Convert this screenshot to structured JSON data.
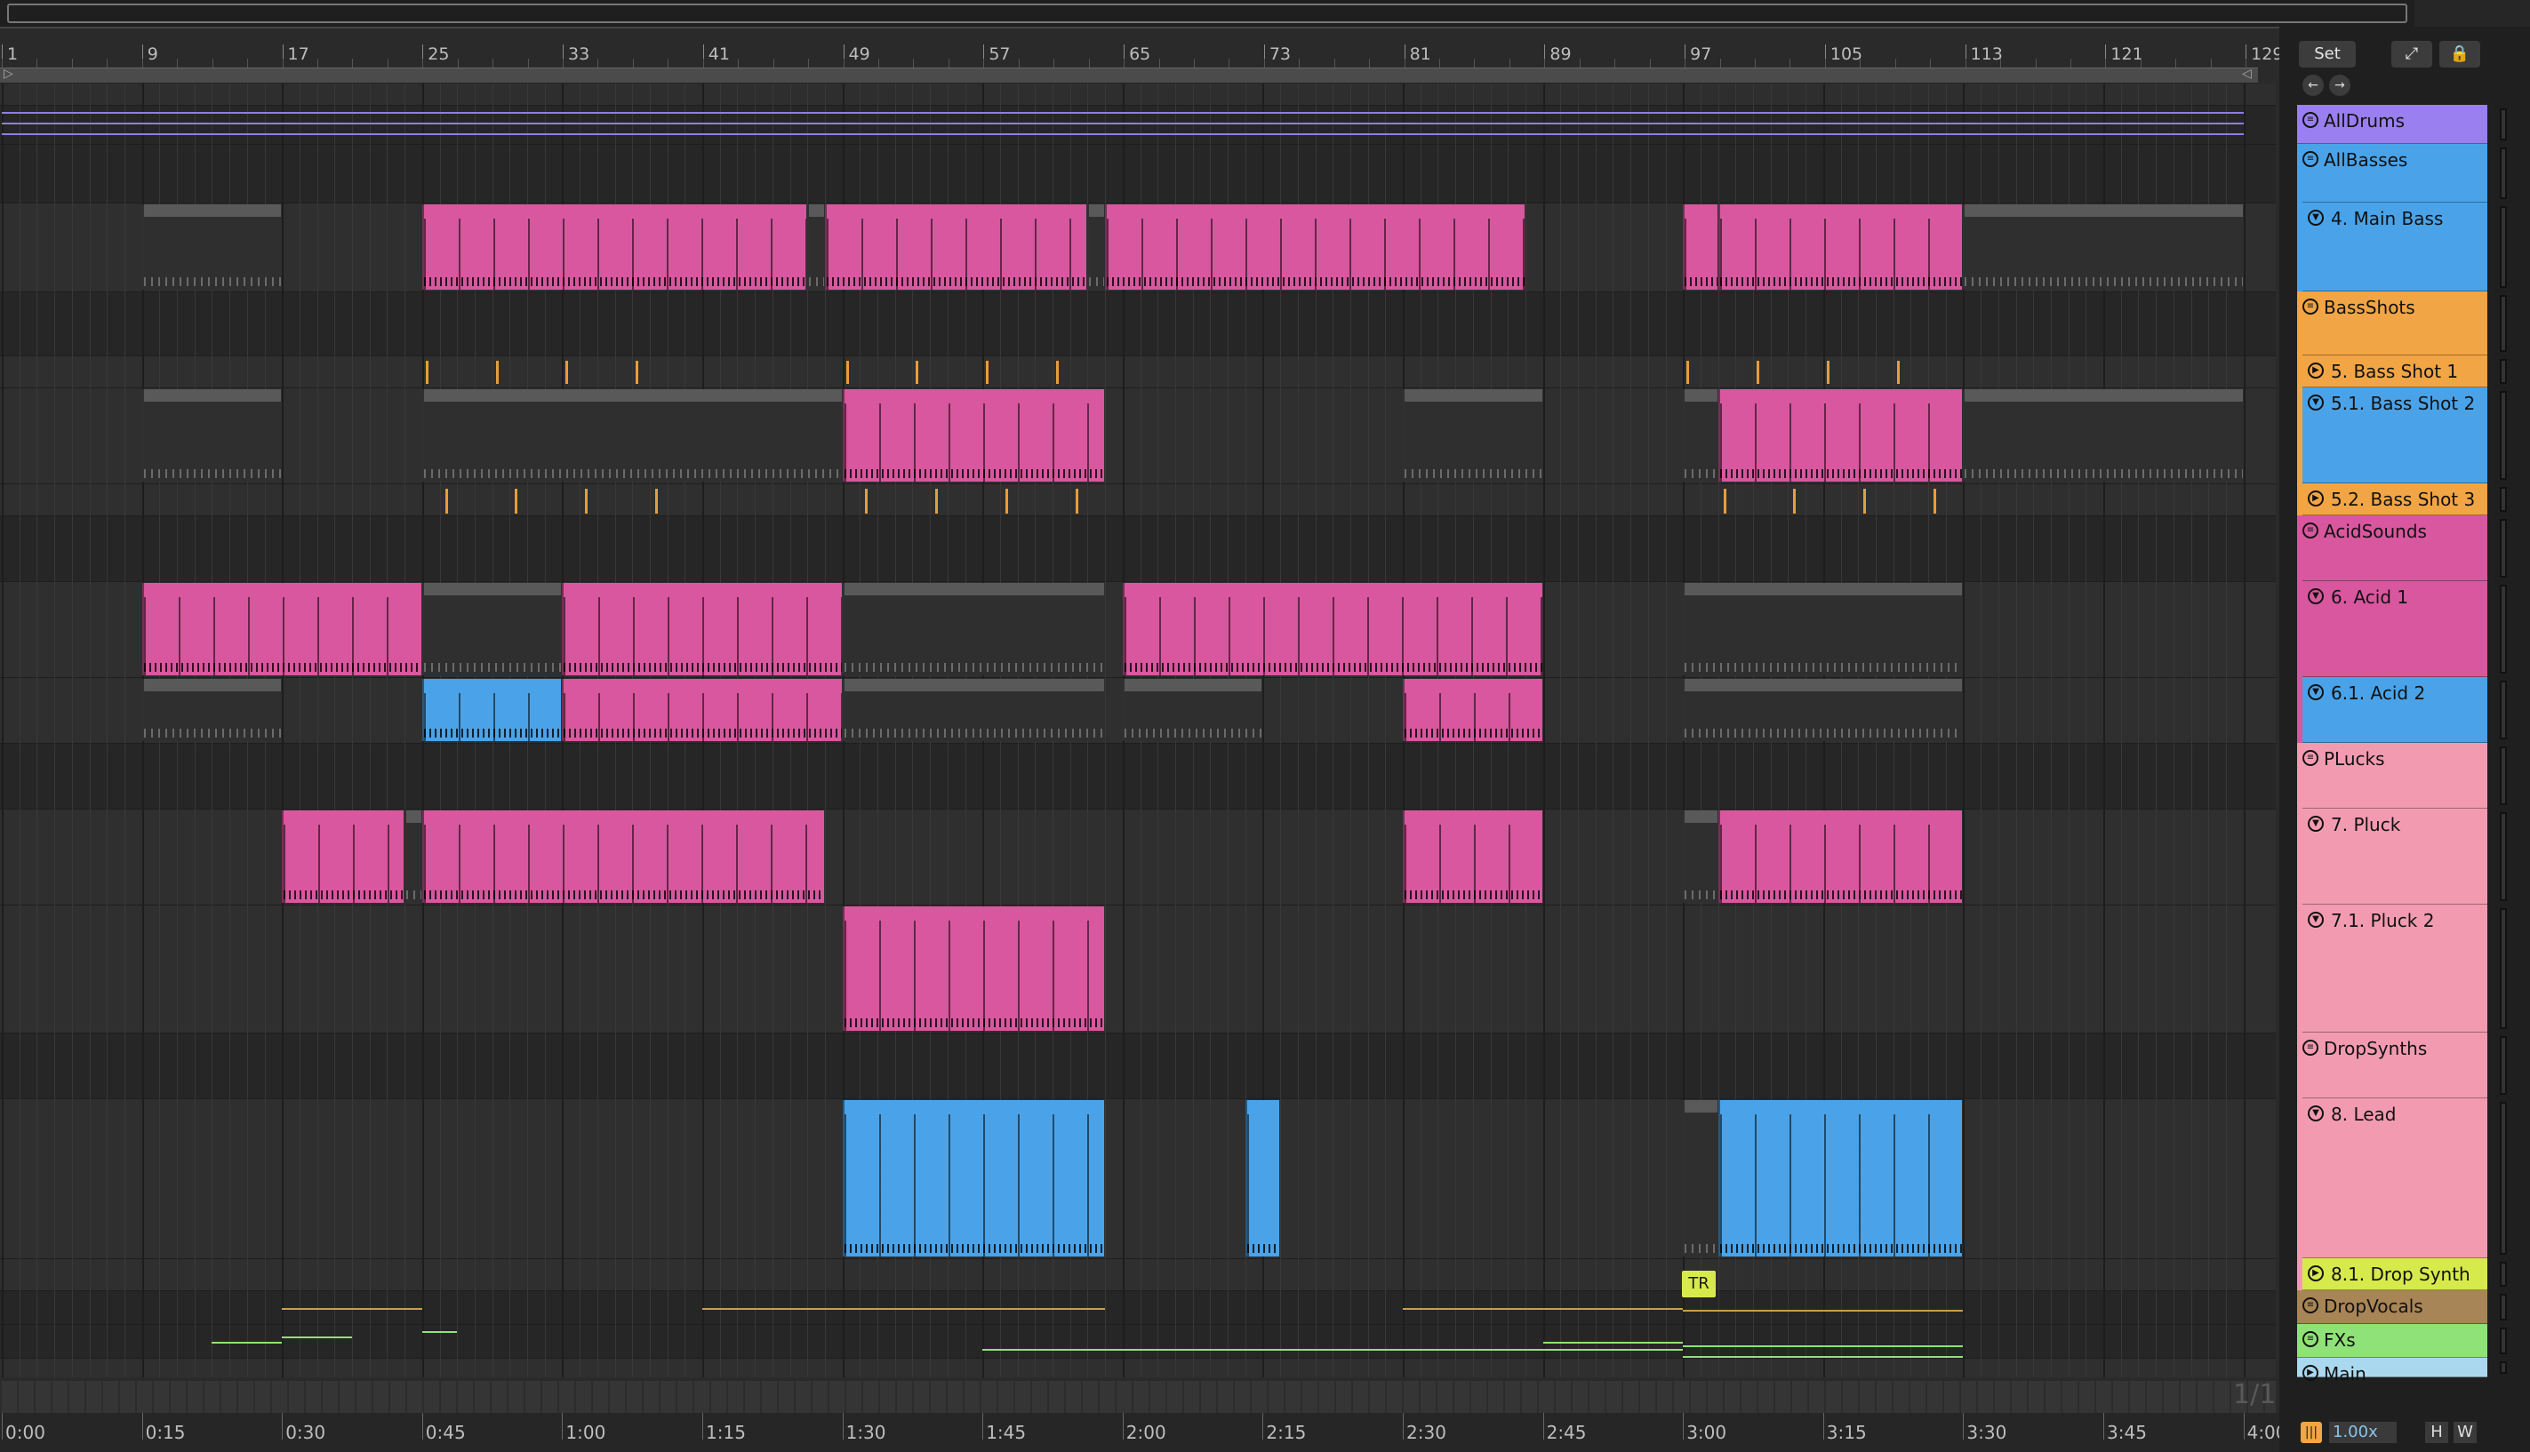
{
  "ruler": {
    "bars": [
      "1",
      "9",
      "17",
      "25",
      "33",
      "41",
      "49",
      "57",
      "65",
      "73",
      "81",
      "89",
      "97",
      "105",
      "113",
      "121",
      "129"
    ]
  },
  "time_ruler": {
    "labels": [
      "0:00",
      "0:15",
      "0:30",
      "0:45",
      "1:00",
      "1:15",
      "1:30",
      "1:45",
      "2:00",
      "2:15",
      "2:30",
      "2:45",
      "3:00",
      "3:15",
      "3:30",
      "3:45",
      "4:00"
    ]
  },
  "controls": {
    "set_label": "Set",
    "expand_icon": "expand-arrows-icon",
    "lock_icon": "lock-icon",
    "back_icon": "arrow-left-icon",
    "forward_icon": "arrow-right-icon"
  },
  "page_indicator": "1/1",
  "locator": {
    "label": "TR"
  },
  "tracks": [
    {
      "name": "AllDrums",
      "kind": "group",
      "color": "#9a7ff0"
    },
    {
      "name": "AllBasses",
      "kind": "group",
      "color": "#4aa3e8"
    },
    {
      "name": "4. Main Bass",
      "kind": "midi",
      "color": "#4aa3e8"
    },
    {
      "name": "BassShots",
      "kind": "group",
      "color": "#f2a544"
    },
    {
      "name": "5. Bass Shot 1",
      "kind": "audio",
      "color": "#f2a544"
    },
    {
      "name": "5.1. Bass Shot 2",
      "kind": "midi",
      "color": "#4aa3e8"
    },
    {
      "name": "5.2. Bass Shot 3",
      "kind": "audio",
      "color": "#f2a544"
    },
    {
      "name": "AcidSounds",
      "kind": "group",
      "color": "#d9579f"
    },
    {
      "name": "6. Acid 1",
      "kind": "midi",
      "color": "#d9579f"
    },
    {
      "name": "6.1. Acid 2",
      "kind": "midi",
      "color": "#4aa3e8"
    },
    {
      "name": "PLucks",
      "kind": "group",
      "color": "#f29bb0"
    },
    {
      "name": "7. Pluck",
      "kind": "midi",
      "color": "#f29bb0"
    },
    {
      "name": "7.1. Pluck 2",
      "kind": "midi",
      "color": "#f29bb0"
    },
    {
      "name": "DropSynths",
      "kind": "group",
      "color": "#f29bb0"
    },
    {
      "name": "8. Lead",
      "kind": "midi",
      "color": "#f29bb0"
    },
    {
      "name": "8.1. Drop Synth",
      "kind": "audio",
      "color": "#d7ea4b"
    },
    {
      "name": "DropVocals",
      "kind": "group",
      "color": "#a88556"
    },
    {
      "name": "FXs",
      "kind": "group",
      "color": "#8fe277"
    },
    {
      "name": "Main",
      "kind": "main",
      "color": "#a9d8ef"
    }
  ],
  "status": {
    "zoom": "1.00x",
    "h_label": "H",
    "w_label": "W"
  },
  "colors": {
    "pink": "#d9579f",
    "blue": "#4aa3e8",
    "gray": "#595959",
    "orange": "#e79d3b"
  }
}
